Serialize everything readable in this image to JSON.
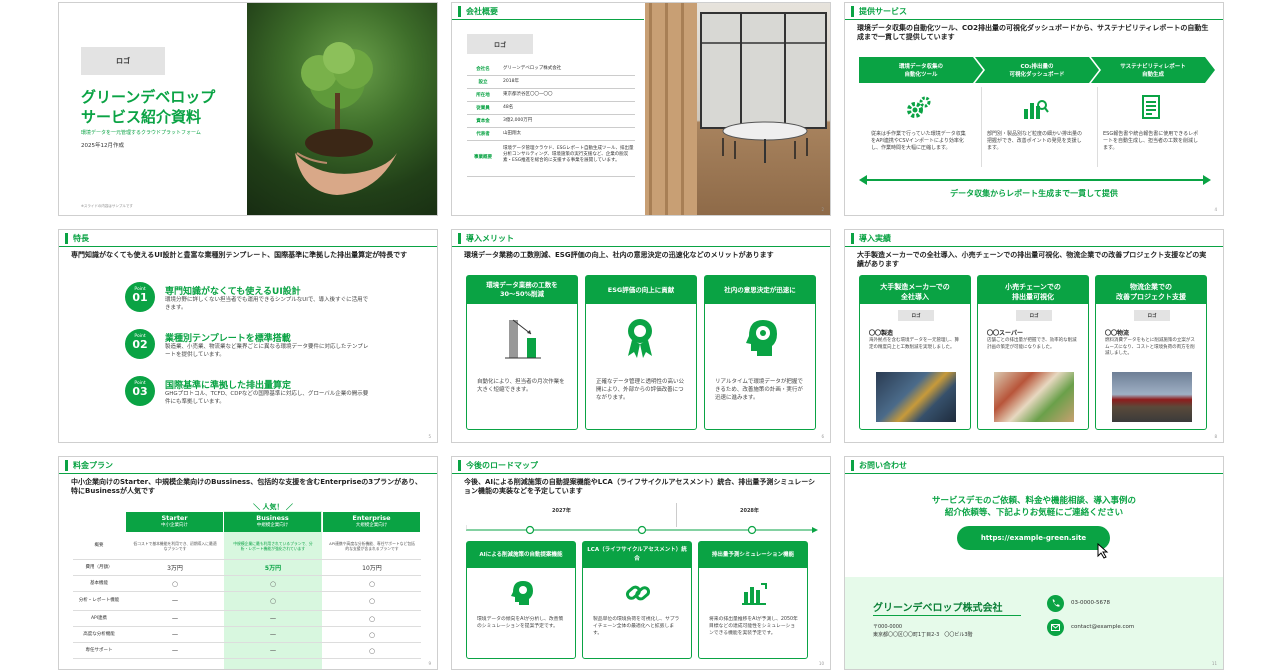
{
  "s1": {
    "logo": "ロゴ",
    "title1": "グリーンデベロップ",
    "title2": "サービス紹介資料",
    "subtitle": "環境データを一元管理するクラウドプラットフォーム",
    "date": "2025年12月作成",
    "footnote": "※スライドの内容はサンプルです"
  },
  "s2": {
    "header": "会社概要",
    "logo": "ロゴ",
    "page": "2",
    "rows": [
      {
        "k": "会社名",
        "v": "グリーンデベロップ株式会社"
      },
      {
        "k": "設立",
        "v": "2018年"
      },
      {
        "k": "所在地",
        "v": "東京都渋谷区〇〇一〇〇"
      },
      {
        "k": "従業員",
        "v": "48名"
      },
      {
        "k": "資本金",
        "v": "3億2,000万円"
      },
      {
        "k": "代表者",
        "v": "山田翔太"
      },
      {
        "k": "事業概要",
        "v": "環境データ管理クラウド、ESGレポート自動生成ツール、排出量分析コンサルティング、環境施策の実行支援など、企業の脱炭素・ESG推進を総合的に支援する事業を展開しています。"
      }
    ]
  },
  "s3": {
    "header": "提供サービス",
    "page": "4",
    "lead": "環境データ収集の自動化ツール、CO2排出量の可視化ダッシュボードから、サステナビリティレポートの自動生成まで一貫して提供しています",
    "steps": [
      {
        "t1": "環境データ収集の",
        "t2": "自動化ツール",
        "icon": "gears-icon",
        "d": "従来は手作業で行っていた環境データ収集をAPI連携やCSVインポートにより効率化し、作業時間を大幅に圧縮します。"
      },
      {
        "t1": "CO₂排出量の",
        "t2": "可視化ダッシュボード",
        "icon": "chart-icon",
        "d": "部門別・製品別など粒度の細かい排出量の把握ができ、改善ポイントの発見を支援します。"
      },
      {
        "t1": "サステナビリティレポート",
        "t2": "自動生成",
        "icon": "document-icon",
        "d": "ESG報告書や統合報告書に使用できるレポートを自動生成し、担当者の工数を削減します。"
      }
    ],
    "bottom": "データ収集からレポート生成まで一貫して提供"
  },
  "s4": {
    "header": "特長",
    "page": "5",
    "lead": "専門知識がなくても使えるUI設計と豊富な業種別テンプレート、国際基準に準拠した排出量算定が特長です",
    "items": [
      {
        "p": "Point",
        "n": "01",
        "t": "専門知識がなくても使えるUI設計",
        "d": "環境分野に詳しくない担当者でも運用できるシンプルなUIで、導入後すぐに活用できます。"
      },
      {
        "p": "Point",
        "n": "02",
        "t": "業種別テンプレートを標準搭載",
        "d": "製造業、小売業、物流業など業界ごとに異なる環境データ要件に対応したテンプレートを提供しています。"
      },
      {
        "p": "Point",
        "n": "03",
        "t": "国際基準に準拠した排出量算定",
        "d": "GHGプロトコル、TCFD、CDPなどの国際基準に対応し、グローバル企業の開示要件にも準拠しています。"
      }
    ]
  },
  "s5": {
    "header": "導入メリット",
    "page": "6",
    "lead": "環境データ業務の工数削減、ESG評価の向上、社内の意思決定の迅速化などのメリットがあります",
    "cards": [
      {
        "t": "環境データ業務の工数を30〜50%削減",
        "icon": "bar-chart-icon",
        "d": "自動化により、担当者の月次作業を大きく短縮できます。"
      },
      {
        "t": "ESG評価の向上に貢献",
        "icon": "award-icon",
        "d": "正確なデータ管理と透明性の高い公開により、外部からの評価改善につながります。"
      },
      {
        "t": "社内の意思決定が迅速に",
        "icon": "brain-head-icon",
        "d": "リアルタイムで環境データが把握できるため、改善施策の計画・実行が迅速に進みます。"
      }
    ]
  },
  "s6": {
    "header": "導入実績",
    "page": "8",
    "lead": "大手製造メーカーでの全社導入、小売チェーンでの排出量可視化、物流企業での改善プロジェクト支援などの実績があります",
    "cards": [
      {
        "t1": "大手製造メーカーでの",
        "t2": "全社導入",
        "logo": "ロゴ",
        "co": "〇〇製造",
        "d": "海外拠点を含む環境データを一元管理し、算定の精度向上と工数削減を実現しました。"
      },
      {
        "t1": "小売チェーンでの",
        "t2": "排出量可視化",
        "logo": "ロゴ",
        "co": "〇〇スーパー",
        "d": "店舗ごとの排出量が把握でき、効率的な削減計画の策定が可能になりました。"
      },
      {
        "t1": "物流企業での",
        "t2": "改善プロジェクト支援",
        "logo": "ロゴ",
        "co": "〇〇物流",
        "d": "燃料消費データをもとに削減施策の立案がスムーズになり、コストと環境負荷の両方を削減しました。"
      }
    ]
  },
  "s7": {
    "header": "料金プラン",
    "page": "9",
    "lead": "中小企業向けのStarter、中規模企業向けのBussiness、包括的な支援を含むEnterpriseの3プランがあり、特にBusinessが人気です",
    "popular": "＼ 人気！ ／",
    "plans": [
      {
        "n": "Starter",
        "s": "中小企業向け"
      },
      {
        "n": "Business",
        "s": "中規模企業向け"
      },
      {
        "n": "Enterprise",
        "s": "大規模企業向け"
      }
    ],
    "rows": [
      {
        "k": "概要",
        "v": [
          "低コストで基本機能を利用でき、初期導入に最適なプランです",
          "中規模企業に最も利用されているプランで、分析・レポート機能が強化されています",
          "API連携や高度な分析機能、専任サポートなど包括的な支援が含まれるプランです"
        ]
      },
      {
        "k": "費用（月額）",
        "v": [
          "3万円",
          "5万円",
          "10万円"
        ]
      },
      {
        "k": "基本機能",
        "v": [
          "○",
          "○",
          "○"
        ]
      },
      {
        "k": "分析・レポート機能",
        "v": [
          "ー",
          "○",
          "○"
        ]
      },
      {
        "k": "API連携",
        "v": [
          "ー",
          "ー",
          "○"
        ]
      },
      {
        "k": "高度な分析機能",
        "v": [
          "ー",
          "ー",
          "○"
        ]
      },
      {
        "k": "専任サポート",
        "v": [
          "ー",
          "ー",
          "○"
        ]
      }
    ]
  },
  "s8": {
    "header": "今後のロードマップ",
    "page": "10",
    "lead": "今後、AIによる削減施策の自動提案機能やLCA（ライフサイクルアセスメント）統合、排出量予測シミュレーション機能の実装などを予定しています",
    "years": [
      "2027年",
      "2028年"
    ],
    "cards": [
      {
        "t": "AIによる削減施策の自動提案機能",
        "icon": "ai-head-icon",
        "d": "環境データの傾向をAIが分析し、改善策のシミュレーションを提案予定です。"
      },
      {
        "t": "LCA（ライフサイクルアセスメント）統合",
        "icon": "link-icon",
        "d": "製品単位の環境負荷を可視化し、サプライチェーン全体の最適化へと拡張します。"
      },
      {
        "t": "排出量予測シミュレーション機能",
        "icon": "forecast-chart-icon",
        "d": "将来の排出量推移をAIが予測し、2050年目標などの達成可能性をシミュレーションできる機能を実装予定です。"
      }
    ]
  },
  "s9": {
    "header": "お問い合わせ",
    "page": "11",
    "msg1": "サービスデモのご依頼、料金や機能相談、導入事例の",
    "msg2": "紹介依頼等、下記よりお気軽にご連絡ください",
    "url": "https://example-green.site",
    "company": "グリーンデベロップ株式会社",
    "zip": "〒000-0000",
    "address": "東京都〇〇区〇〇町1丁目2-3　〇〇ビル3階",
    "phone": "03-0000-5678",
    "email": "contact@example.com"
  }
}
